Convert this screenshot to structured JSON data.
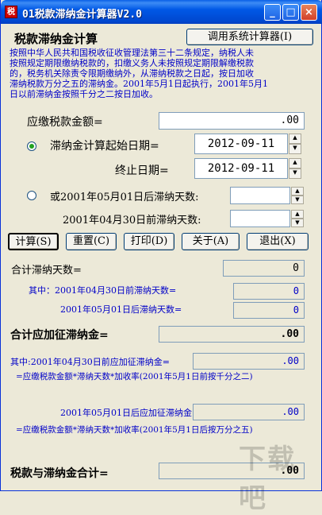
{
  "window": {
    "icon_text": "税",
    "title": "01税款滞纳金计算器V2.0",
    "min_label": "_",
    "max_label": "□",
    "close_label": "×"
  },
  "header": {
    "heading": "税款滞纳金计算",
    "system_calc_button": "调用系统计算器(I)"
  },
  "description": [
    "按照中华人民共和国税收征收管理法第三十二条规定，纳税人未",
    "按照规定期限缴纳税款的，扣缴义务人未按照规定期限解缴税款",
    "的，税务机关除责令限期缴纳外，从滞纳税款之日起，按日加收",
    "滞纳税款万分之五的滞纳金。2001年5月1日起执行，2001年5月1",
    "日以前滞纳金按照千分之二按日加收。"
  ],
  "form": {
    "tax_amount_label": "应缴税款金额=",
    "tax_amount_value": ".00",
    "start_date_label": "滞纳金计算起始日期=",
    "start_date_value": "2012-09-11",
    "end_date_label": "终止日期=",
    "end_date_value": "2012-09-11",
    "after_days_label": "或2001年05月01日后滞纳天数:",
    "after_days_value": "",
    "before_days_label": "2001年04月30日前滞纳天数:",
    "before_days_value": ""
  },
  "buttons": {
    "calculate": "计算(S)",
    "reset": "重置(C)",
    "print": "打印(D)",
    "about": "关于(A)",
    "exit": "退出(X)"
  },
  "results": {
    "total_days_label": "合计滞纳天数=",
    "total_days_value": "0",
    "before_days_label": "其中：2001年04月30日前滞纳天数=",
    "before_days_value": "0",
    "after_days_label": "2001年05月01日后滞纳天数=",
    "after_days_value": "0",
    "total_fee_label": "合计应加征滞纳金=",
    "total_fee_value": ".00",
    "before_fee_label": "其中:2001年04月30日前应加征滞纳金=",
    "before_fee_value": ".00",
    "before_formula": "=应缴税款金额*滞纳天数*加收率(2001年5月1日前按千分之二)",
    "after_fee_label": "2001年05月01日后应加征滞纳金=",
    "after_fee_value": ".00",
    "after_formula": "=应缴税款金额*滞纳天数*加收率(2001年5月1日后按万分之五)",
    "grand_total_label": "税款与滞纳金合计=",
    "grand_total_value": ".00"
  },
  "watermark": "下载吧"
}
